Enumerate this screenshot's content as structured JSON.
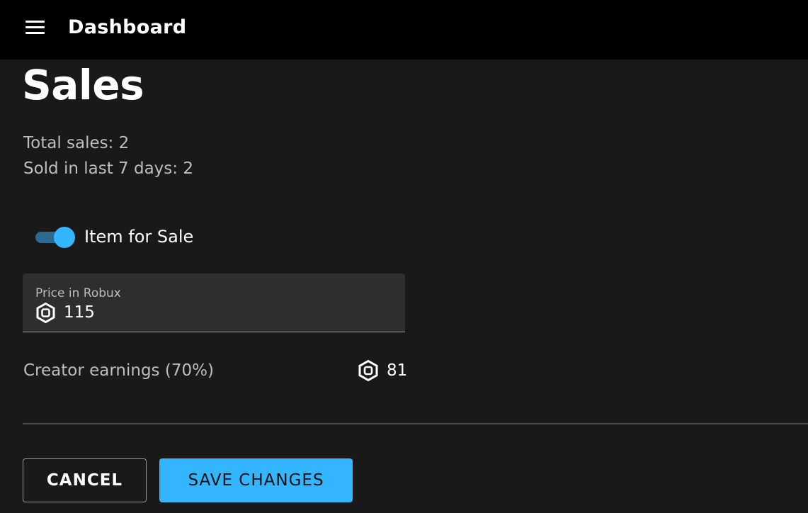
{
  "header": {
    "title": "Dashboard",
    "menu_icon": "hamburger-menu-icon"
  },
  "page": {
    "title": "Sales"
  },
  "stats": {
    "total_sales": "Total sales: 2",
    "sold_last_7_days": "Sold in last 7 days: 2"
  },
  "sale_toggle": {
    "label": "Item for Sale",
    "enabled": true,
    "accent_color": "#33b5ff"
  },
  "price_field": {
    "label": "Price in Robux",
    "value": "115",
    "icon": "robux-icon"
  },
  "earnings": {
    "label": "Creator earnings (70%)",
    "value": "81",
    "icon": "robux-icon"
  },
  "actions": {
    "cancel_label": "CANCEL",
    "save_label": "SAVE CHANGES",
    "save_color": "#33b5ff"
  }
}
